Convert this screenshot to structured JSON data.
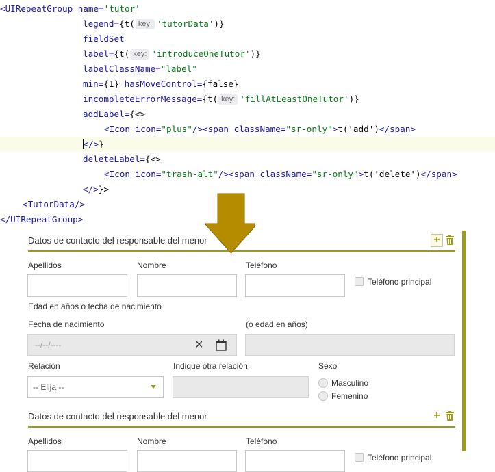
{
  "code": {
    "l1_tag_open": "<UIRepeatGroup",
    "l1_attr_name": " name=",
    "l1_val_name": "'tutor'",
    "l2_attr": "legend=",
    "l2_pre": "{t(",
    "l2_hint": "key:",
    "l2_str": "'tutorData'",
    "l2_post": ")}",
    "l3": "fieldSet",
    "l4_attr": "label=",
    "l4_pre": "{t(",
    "l4_hint": "key:",
    "l4_str": "'introduceOneTutor'",
    "l4_post": ")}",
    "l5_attr": "labelClassName=",
    "l5_str": "\"label\"",
    "l6_attr1": "min=",
    "l6_val1": "{1}",
    "l6_attr2": " hasMoveControl=",
    "l6_val2": "{false}",
    "l7_attr": "incompleteErrorMessage=",
    "l7_pre": "{t(",
    "l7_hint": "key:",
    "l7_str": "'fillAtLeastOneTutor'",
    "l7_post": ")}",
    "l8_attr": "addLabel=",
    "l8_val": "{<>",
    "l9_tag": "<Icon",
    "l9_attr": " icon=",
    "l9_str": "\"plus\"",
    "l9_tag2": "/><span",
    "l9_attr2": " className=",
    "l9_str2": "\"sr-only\"",
    "l9_tag3": ">",
    "l9_text": "t('add')",
    "l9_tag4": "</span>",
    "l10_tag": "</>",
    "l10_post": "}",
    "l11_attr": "deleteLabel=",
    "l11_val": "{<>",
    "l12_tag": "<Icon",
    "l12_attr": " icon=",
    "l12_str": "\"trash-alt\"",
    "l12_tag2": "/><span",
    "l12_attr2": " className=",
    "l12_str2": "\"sr-only\"",
    "l12_tag3": ">",
    "l12_text": "t('delete')",
    "l12_tag4": "</span>",
    "l13_tag": "</>",
    "l13_post": "}>",
    "l14": "<TutorData/>",
    "l15": "</UIRepeatGroup>"
  },
  "form": {
    "section1": {
      "title": "Datos de contacto del responsable del menor",
      "apellidos": "Apellidos",
      "nombre": "Nombre",
      "telefono": "Teléfono",
      "telefono_principal": "Teléfono principal",
      "edad_heading": "Edad en años o fecha de nacimiento",
      "fecha_label": "Fecha de nacimiento",
      "fecha_placeholder": "--/--/----",
      "edad_label": "(o edad en años)",
      "relacion_label": "Relación",
      "relacion_value": "-- Elija --",
      "otra_relacion_label": "Indique otra relación",
      "sexo_label": "Sexo",
      "masculino": "Masculino",
      "femenino": "Femenino"
    },
    "section2": {
      "title": "Datos de contacto del responsable del menor",
      "apellidos": "Apellidos",
      "nombre": "Nombre",
      "telefono": "Teléfono",
      "telefono_principal": "Teléfono principal"
    },
    "icons": {
      "add": "plus-icon",
      "delete": "trash-icon",
      "clear": "close-icon",
      "calendar": "calendar-icon",
      "dropdown": "caret-down-icon",
      "arrow": "down-arrow-icon"
    },
    "colors": {
      "accent": "#9b9b1f",
      "arrow": "#b58c00"
    }
  }
}
